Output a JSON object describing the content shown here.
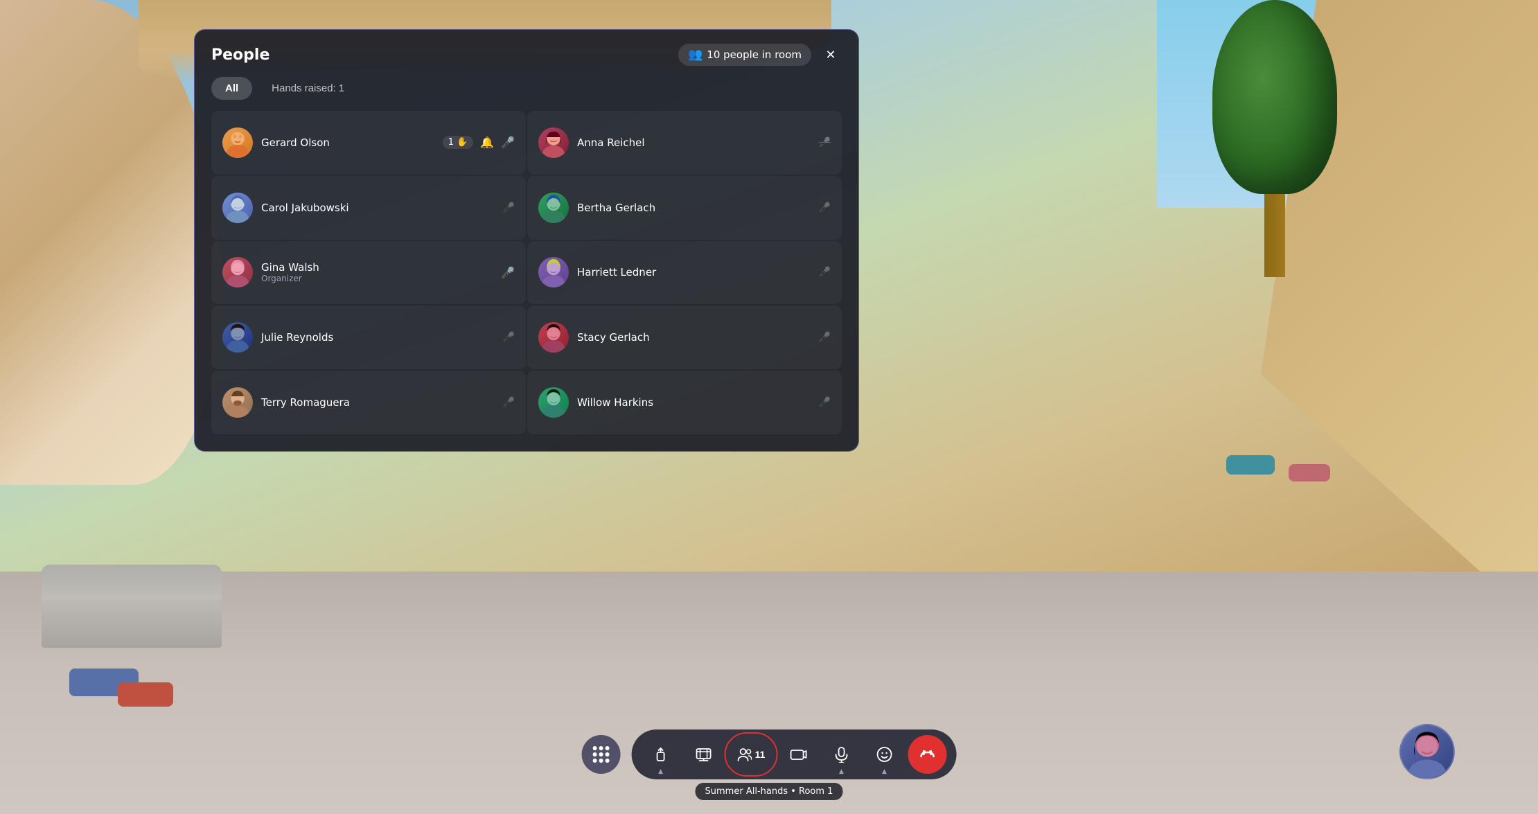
{
  "background": {
    "colors": {
      "sky": "#87ceeb",
      "wall": "#c8a870",
      "floor": "#c0b8b0"
    }
  },
  "panel": {
    "title": "People",
    "people_count_label": "10 people in room",
    "close_label": "×",
    "filters": [
      {
        "id": "all",
        "label": "All",
        "active": true
      },
      {
        "id": "hands",
        "label": "Hands raised: 1",
        "active": false
      }
    ],
    "people": [
      {
        "id": "gerard",
        "name": "Gerard Olson",
        "role": "",
        "column": 0,
        "avatar_class": "avatar-gerard",
        "avatar_emoji": "🧑",
        "hand_count": "1",
        "has_hand": true,
        "has_bell": true,
        "mic": "active",
        "muted": false
      },
      {
        "id": "anna",
        "name": "Anna Reichel",
        "role": "",
        "column": 1,
        "avatar_class": "avatar-anna",
        "avatar_emoji": "👩",
        "has_hand": false,
        "has_bell": false,
        "mic": "muted",
        "muted": true
      },
      {
        "id": "carol",
        "name": "Carol Jakubowski",
        "role": "",
        "column": 0,
        "avatar_class": "avatar-carol",
        "avatar_emoji": "👩",
        "has_hand": false,
        "has_bell": false,
        "mic": "muted",
        "muted": true
      },
      {
        "id": "bertha",
        "name": "Bertha Gerlach",
        "role": "",
        "column": 1,
        "avatar_class": "avatar-bertha",
        "avatar_emoji": "👩",
        "has_hand": false,
        "has_bell": false,
        "mic": "muted",
        "muted": true
      },
      {
        "id": "gina",
        "name": "Gina Walsh",
        "role": "Organizer",
        "column": 0,
        "avatar_class": "avatar-gina",
        "avatar_emoji": "👩",
        "has_hand": false,
        "has_bell": false,
        "mic": "active",
        "muted": false
      },
      {
        "id": "harriett",
        "name": "Harriett Ledner",
        "role": "",
        "column": 1,
        "avatar_class": "avatar-harriett",
        "avatar_emoji": "👩",
        "has_hand": false,
        "has_bell": false,
        "mic": "muted",
        "muted": true
      },
      {
        "id": "julie",
        "name": "Julie Reynolds",
        "role": "",
        "column": 0,
        "avatar_class": "avatar-julie",
        "avatar_emoji": "👩",
        "has_hand": false,
        "has_bell": false,
        "mic": "muted",
        "muted": true
      },
      {
        "id": "stacy",
        "name": "Stacy Gerlach",
        "role": "",
        "column": 1,
        "avatar_class": "avatar-stacy",
        "avatar_emoji": "👩",
        "has_hand": false,
        "has_bell": false,
        "mic": "muted",
        "muted": true
      },
      {
        "id": "terry",
        "name": "Terry Romaguera",
        "role": "",
        "column": 0,
        "avatar_class": "avatar-terry",
        "avatar_emoji": "🧔",
        "has_hand": false,
        "has_bell": false,
        "mic": "muted",
        "muted": true
      },
      {
        "id": "willow",
        "name": "Willow Harkins",
        "role": "",
        "column": 1,
        "avatar_class": "avatar-willow",
        "avatar_emoji": "👩",
        "has_hand": false,
        "has_bell": false,
        "mic": "muted",
        "muted": true
      }
    ]
  },
  "toolbar": {
    "session_label": "Summer All-hands • Room 1",
    "buttons": [
      {
        "id": "share",
        "icon": "⬆",
        "label": "",
        "active": false,
        "has_chevron": true
      },
      {
        "id": "media",
        "icon": "🎬",
        "label": "",
        "active": false
      },
      {
        "id": "people",
        "icon": "👤",
        "label": "11",
        "active": true,
        "highlighted": true
      },
      {
        "id": "camera",
        "icon": "📷",
        "label": "",
        "active": false
      },
      {
        "id": "mic",
        "icon": "🎤",
        "label": "",
        "active": false,
        "has_chevron": true
      },
      {
        "id": "react",
        "icon": "😊",
        "label": "",
        "active": false,
        "has_chevron": true
      },
      {
        "id": "leave",
        "icon": "📤",
        "label": "",
        "active": false,
        "is_red": true
      }
    ]
  },
  "icons": {
    "close": "✕",
    "people_group": "👥",
    "hand_raise": "✋",
    "mic_on": "🎤",
    "mic_off": "🎤",
    "bell": "🔔"
  }
}
